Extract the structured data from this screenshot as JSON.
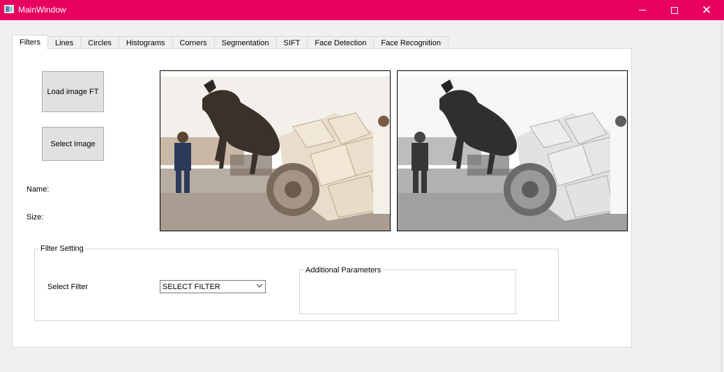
{
  "window": {
    "title": "MainWindow",
    "accent_color": "#e8005f",
    "icons": [
      "app-icon",
      "minimize-icon",
      "maximize-icon",
      "close-icon"
    ]
  },
  "tabs": [
    {
      "label": "Filters",
      "active": true
    },
    {
      "label": "Lines",
      "active": false
    },
    {
      "label": "Circles",
      "active": false
    },
    {
      "label": "Histograms",
      "active": false
    },
    {
      "label": "Corners",
      "active": false
    },
    {
      "label": "Segmentation",
      "active": false
    },
    {
      "label": "SIFT",
      "active": false
    },
    {
      "label": "Face Detection",
      "active": false
    },
    {
      "label": "Face Recognition",
      "active": false
    }
  ],
  "filters_tab": {
    "load_button": "Load image FT",
    "select_button": "Select Image",
    "name_label": "Name:",
    "size_label": "Size:",
    "images": {
      "original": "donkey-cart-photo (color)",
      "filtered": "donkey-cart-photo (grayscale)"
    },
    "filter_setting": {
      "title": "Filter Setting",
      "select_filter_label": "Select Filter",
      "select_value": "SELECT FILTER",
      "additional_params_title": "Additional Parameters"
    }
  }
}
